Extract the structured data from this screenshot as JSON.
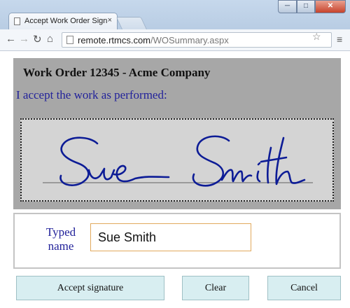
{
  "browser": {
    "tab_title": "Accept Work Order Signat",
    "tab_close": "×",
    "address_host": "remote.rtmcs.com",
    "address_path": "/WOSummary.aspx",
    "icons": {
      "back": "back-arrow-icon",
      "forward": "forward-arrow-icon",
      "reload": "reload-icon",
      "home": "home-icon",
      "bookmark": "star-icon",
      "menu": "hamburger-menu-icon"
    }
  },
  "page": {
    "title": "Work Order 12345 - Acme Company",
    "accept_statement": "I accept the work as performed:",
    "signature_text": "Sue Smith",
    "typed_name_label_line1": "Typed",
    "typed_name_label_line2": "name",
    "typed_name_value": "Sue Smith"
  },
  "buttons": {
    "accept": "Accept signature",
    "clear": "Clear",
    "cancel": "Cancel"
  },
  "colors": {
    "prompt_text": "#22229a",
    "signature_ink": "#0d1c96",
    "panel_grey": "#a7a7a7",
    "button_bg": "#d8eef1"
  }
}
